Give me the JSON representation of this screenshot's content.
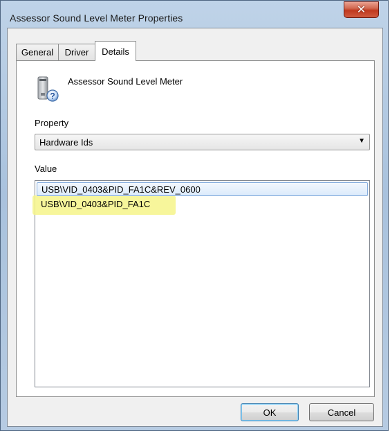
{
  "window": {
    "title": "Assessor Sound Level Meter Properties",
    "close_glyph": "✕"
  },
  "tabs": [
    {
      "label": "General"
    },
    {
      "label": "Driver"
    },
    {
      "label": "Details"
    }
  ],
  "active_tab": "Details",
  "device": {
    "icon": "usb-device-unknown-icon",
    "name": "Assessor Sound Level Meter"
  },
  "property": {
    "label": "Property",
    "selected": "Hardware Ids"
  },
  "value": {
    "label": "Value",
    "items": [
      "USB\\VID_0403&PID_FA1C&REV_0600",
      "USB\\VID_0403&PID_FA1C"
    ]
  },
  "buttons": {
    "ok": "OK",
    "cancel": "Cancel"
  },
  "colors": {
    "highlight": "#f6f58a",
    "selection_border": "#84acdd",
    "close_button": "#c0391f"
  }
}
